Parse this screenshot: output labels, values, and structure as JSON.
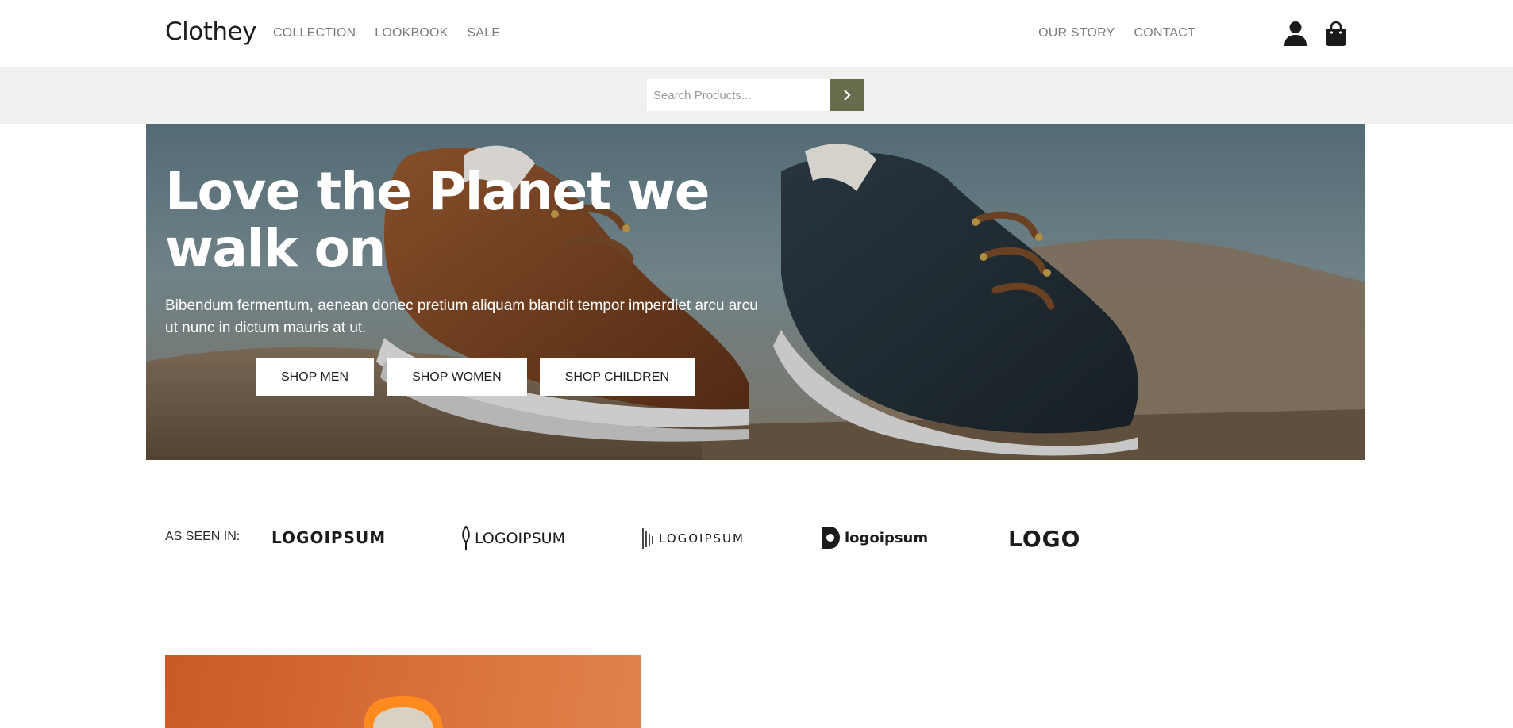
{
  "brand": "Clothey",
  "nav_left": [
    {
      "label": "COLLECTION"
    },
    {
      "label": "LOOKBOOK"
    },
    {
      "label": "SALE"
    }
  ],
  "nav_right": [
    {
      "label": "OUR STORY"
    },
    {
      "label": "CONTACT"
    }
  ],
  "icons": {
    "account": "user-icon",
    "cart": "shopping-bag-icon",
    "search_submit": "chevron-right-icon"
  },
  "search": {
    "placeholder": "Search Products...",
    "value": ""
  },
  "hero": {
    "title": "Love the Planet we walk on",
    "text": "Bibendum fermentum, aenean donec pretium aliquam blandit tempor imperdiet arcu arcu ut nunc in dictum mauris at ut.",
    "buttons": [
      {
        "label": "SHOP MEN"
      },
      {
        "label": "SHOP WOMEN"
      },
      {
        "label": "SHOP CHILDREN"
      }
    ]
  },
  "as_seen_in": {
    "label": "AS SEEN IN:",
    "logos": [
      "LOGOIPSUM",
      "LOGOIPSUM",
      "LOGOIPSUM",
      "logoipsum",
      "LOGO"
    ]
  },
  "colors": {
    "accent": "#686b4c",
    "search_band": "#f0f0ee",
    "divider": "#dcdcdc",
    "product_bg": "#d9703a"
  }
}
